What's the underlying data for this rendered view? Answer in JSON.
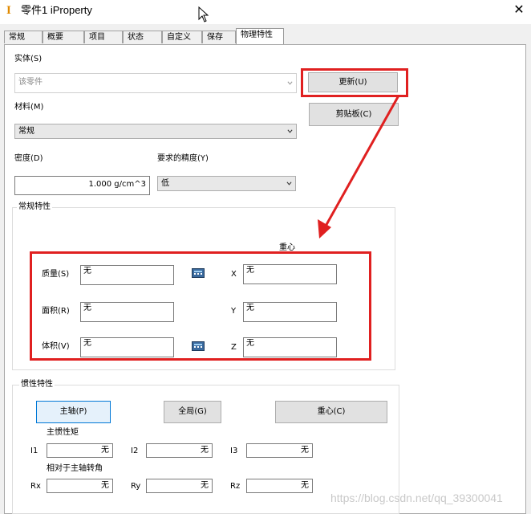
{
  "window": {
    "icon_glyph": "I",
    "title": "零件1 iProperty",
    "close_glyph": "✕"
  },
  "tabs": [
    "常规",
    "概要",
    "项目",
    "状态",
    "自定义",
    "保存",
    "物理特性"
  ],
  "physical": {
    "entity": {
      "label": "实体(S)",
      "value": "该零件"
    },
    "update_button": "更新(U)",
    "clipboard_button": "剪贴板(C)",
    "material": {
      "label": "材料(M)",
      "value": "常规"
    },
    "density": {
      "label": "密度(D)",
      "value": "1.000 g/cm^3"
    },
    "accuracy": {
      "label": "要求的精度(Y)",
      "value": "低"
    },
    "general": {
      "title": "常规特性",
      "center_label": "重心",
      "mass": {
        "label": "质量(S)",
        "value": "无"
      },
      "area": {
        "label": "面积(R)",
        "value": "无"
      },
      "volume": {
        "label": "体积(V)",
        "value": "无"
      },
      "x": {
        "label": "X",
        "value": "无"
      },
      "y": {
        "label": "Y",
        "value": "无"
      },
      "z": {
        "label": "Z",
        "value": "无"
      }
    },
    "inertia": {
      "title": "惯性特性",
      "principal_button": "主轴(P)",
      "global_button": "全局(G)",
      "centroid_button": "重心(C)",
      "principal_moments_label": "主惯性矩",
      "i1": {
        "label": "I1",
        "value": "无"
      },
      "i2": {
        "label": "I2",
        "value": "无"
      },
      "i3": {
        "label": "I3",
        "value": "无"
      },
      "rotation_label": "相对于主轴转角",
      "rx": {
        "label": "Rx",
        "value": "无"
      },
      "ry": {
        "label": "Ry",
        "value": "无"
      },
      "rz": {
        "label": "Rz",
        "value": "无"
      }
    }
  },
  "watermark": "https://blog.csdn.net/qq_39300041",
  "colors": {
    "annotation_red": "#e02020",
    "focus_blue": "#0078d7",
    "icon_orange": "#e08a00"
  },
  "icons": [
    "cursor-icon",
    "calculator-icon",
    "chevron-down-icon",
    "close-icon"
  ]
}
